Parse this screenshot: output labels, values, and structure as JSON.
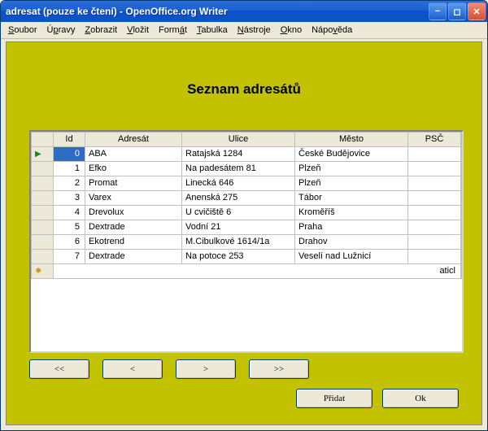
{
  "window": {
    "title": "adresat (pouze ke čtení) - OpenOffice.org Writer"
  },
  "menu": {
    "soubor": "Soubor",
    "upravy": "Úpravy",
    "zobrazit": "Zobrazit",
    "vlozit": "Vložit",
    "format": "Formát",
    "tabulka": "Tabulka",
    "nastroje": "Nástroje",
    "okno": "Okno",
    "napoveda": "Nápověda"
  },
  "heading": "Seznam adresátů",
  "columns": {
    "id": "Id",
    "adresat": "Adresát",
    "ulice": "Ulice",
    "mesto": "Město",
    "psc": "PSČ"
  },
  "rows": [
    {
      "id": "0",
      "adresat": "ABA",
      "ulice": "Ratajská 1284",
      "mesto": "České Budějovice",
      "psc": ""
    },
    {
      "id": "1",
      "adresat": "Efko",
      "ulice": "Na padesátem 81",
      "mesto": "Plzeň",
      "psc": ""
    },
    {
      "id": "2",
      "adresat": "Promat",
      "ulice": "Linecká 646",
      "mesto": "Plzeň",
      "psc": ""
    },
    {
      "id": "3",
      "adresat": "Varex",
      "ulice": "Anenská 275",
      "mesto": "Tábor",
      "psc": ""
    },
    {
      "id": "4",
      "adresat": "Drevolux",
      "ulice": "U cvičiště 6",
      "mesto": "Kroměříš",
      "psc": ""
    },
    {
      "id": "5",
      "adresat": "Dextrade",
      "ulice": "Vodní 21",
      "mesto": "Praha",
      "psc": ""
    },
    {
      "id": "6",
      "adresat": "Ekotrend",
      "ulice": "M.Cibulkové 1614/1a",
      "mesto": "Drahov",
      "psc": ""
    },
    {
      "id": "7",
      "adresat": "Dextrade",
      "ulice": "Na potoce 253",
      "mesto": "Veselí nad Lužnicí",
      "psc": ""
    }
  ],
  "new_row_placeholder": "aticl",
  "nav": {
    "first": "<<",
    "prev": "<",
    "next": ">",
    "last": ">>"
  },
  "actions": {
    "add": "Přidat",
    "ok": "Ok"
  }
}
